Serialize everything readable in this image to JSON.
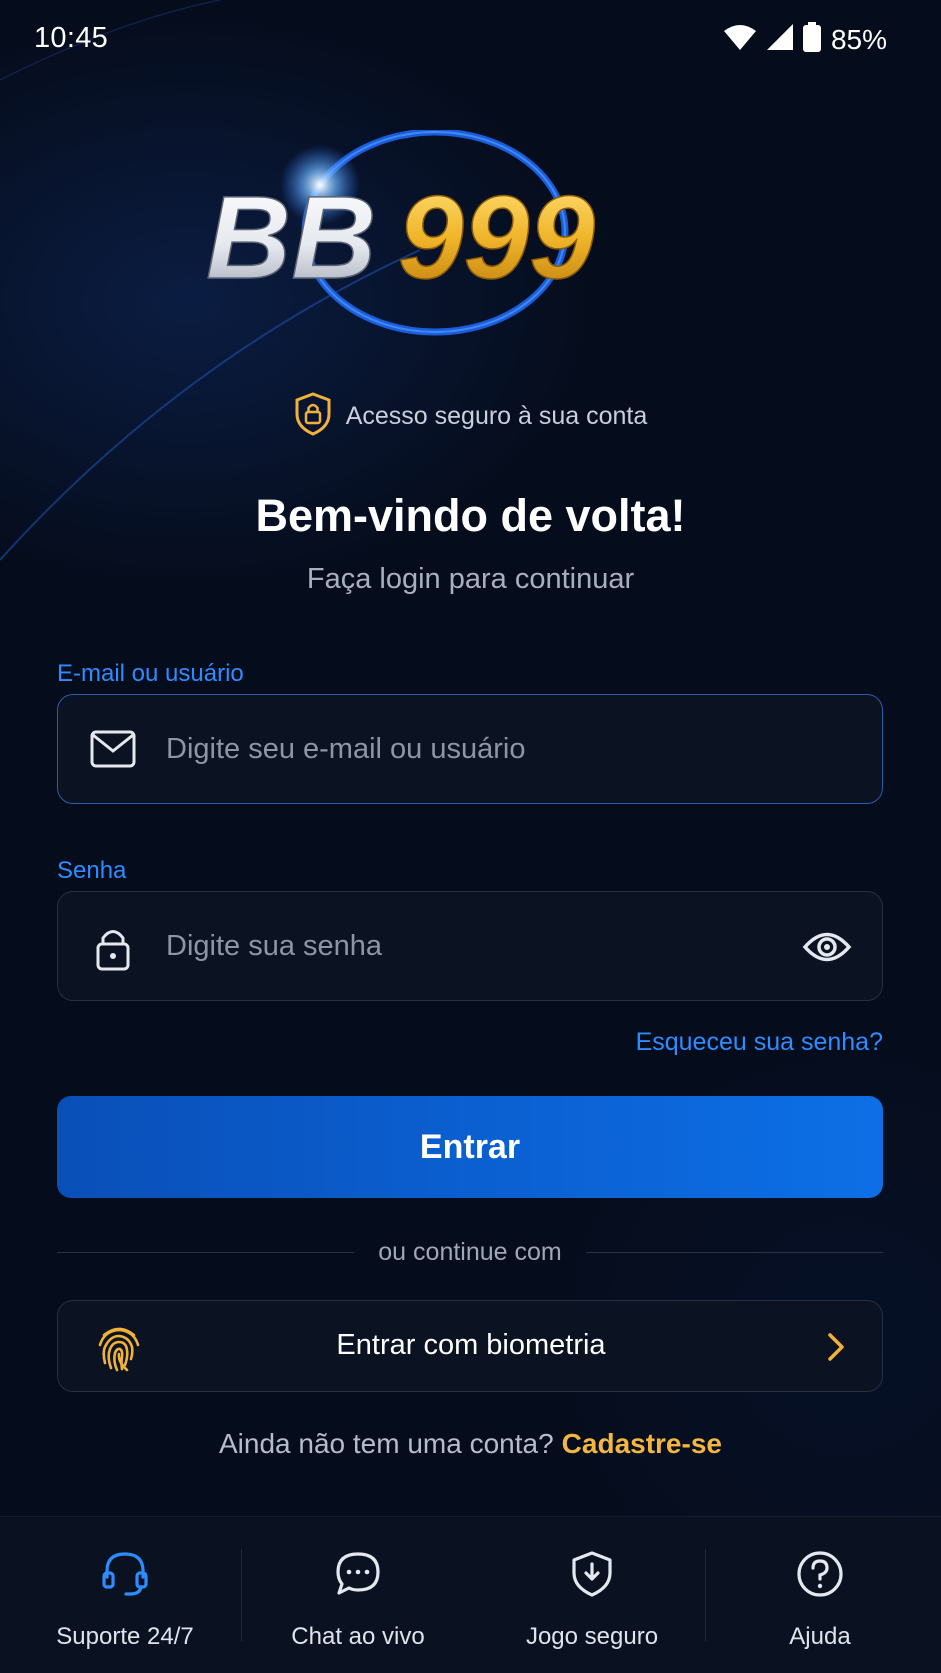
{
  "status_bar": {
    "time": "10:45",
    "battery": "85%",
    "icons": [
      "wifi-icon",
      "signal-icon",
      "battery-icon"
    ]
  },
  "brand": {
    "logo_white": "BB",
    "logo_gold": "999",
    "secure_text": "Acesso seguro à sua conta"
  },
  "welcome": {
    "title": "Bem-vindo de volta!",
    "subtitle": "Faça login para continuar"
  },
  "form": {
    "email_label": "E-mail ou usuário",
    "email_placeholder": "Digite seu e-mail ou usuário",
    "email_value": "",
    "password_label": "Senha",
    "password_placeholder": "Digite sua senha",
    "password_value": "",
    "forgot_label": "Esqueceu sua senha?",
    "submit_label": "Entrar"
  },
  "alt_login": {
    "divider_text": "ou continue com",
    "biometric_label": "Entrar com biometria"
  },
  "signup": {
    "question": "Ainda não tem uma conta?",
    "link": "Cadastre-se"
  },
  "bottom_nav": {
    "items": [
      {
        "label": "Suporte 24/7",
        "icon": "headset-icon"
      },
      {
        "label": "Chat ao vivo",
        "icon": "chat-bubble-icon"
      },
      {
        "label": "Jogo seguro",
        "icon": "shield-icon"
      },
      {
        "label": "Ajuda",
        "icon": "help-icon"
      }
    ]
  },
  "colors": {
    "background": "#050c1b",
    "accent_blue": "#2d8cff",
    "primary_button": "#0b5fd0",
    "gold": "#f3b63f"
  }
}
